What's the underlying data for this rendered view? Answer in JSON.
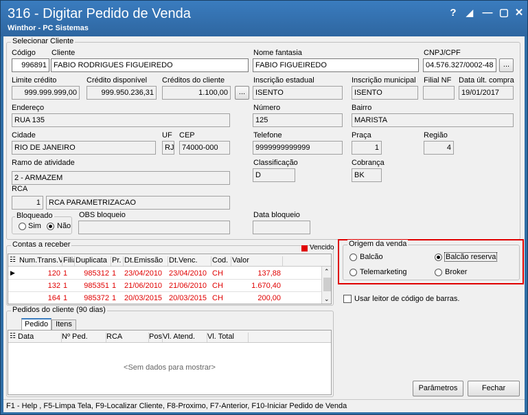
{
  "window": {
    "title": "316 - Digitar Pedido de Venda",
    "subtitle": "Winthor - PC Sistemas",
    "help": "?",
    "restore": "▢",
    "minimize": "—",
    "close": "✕"
  },
  "selecionar": {
    "group_label": "Selecionar Cliente",
    "codigo_label": "Código",
    "codigo": "996891",
    "cliente_label": "Cliente",
    "cliente": "FABIO RODRIGUES FIGUEIREDO",
    "fantasia_label": "Nome fantasia",
    "fantasia": "FABIO FIGUEIREDO",
    "cnpj_label": "CNPJ/CPF",
    "cnpj": "04.576.327/0002-48",
    "limite_label": "Limite crédito",
    "limite": "999.999.999,00",
    "credito_disp_label": "Crédito disponível",
    "credito_disp": "999.950.236,31",
    "creditos_cli_label": "Créditos do cliente",
    "creditos_cli": "1.100,00",
    "ie_label": "Inscrição estadual",
    "ie": "ISENTO",
    "im_label": "Inscrição municipal",
    "im": "ISENTO",
    "filial_label": "Filial NF",
    "filial": "",
    "data_compra_label": "Data últ. compra",
    "data_compra": "19/01/2017",
    "endereco_label": "Endereço",
    "endereco": "RUA 135",
    "numero_label": "Número",
    "numero": "125",
    "bairro_label": "Bairro",
    "bairro": "MARISTA",
    "cidade_label": "Cidade",
    "cidade": "RIO DE JANEIRO",
    "uf_label": "UF",
    "uf": "RJ",
    "cep_label": "CEP",
    "cep": "74000-000",
    "telefone_label": "Telefone",
    "telefone": "9999999999999",
    "praca_label": "Praça",
    "praca": "1",
    "regiao_label": "Região",
    "regiao": "4",
    "ramo_label": "Ramo de atividade",
    "ramo": "2 - ARMAZEM",
    "classificacao_label": "Classificação",
    "classificacao": "D",
    "cobranca_label": "Cobrança",
    "cobranca": "BK",
    "rca_label": "RCA",
    "rca_cod": "1",
    "rca_nome": "RCA PARAMETRIZACAO",
    "bloqueado_label": "Bloqueado",
    "sim": "Sim",
    "nao": "Não",
    "obs_label": "OBS bloqueio",
    "obs": "",
    "data_bloqueio_label": "Data bloqueio",
    "data_bloqueio": "",
    "ellipsis": "..."
  },
  "contas": {
    "group_label": "Contas a receber",
    "vencido_label": "Vencido",
    "vencido_color": "#e00000",
    "headers": [
      "Num.Trans.V",
      "Filia",
      "Duplicata",
      "Pr.",
      "Dt.Emissão",
      "Dt.Venc.",
      "Cod.",
      "Valor"
    ],
    "rows": [
      [
        "120",
        "1",
        "985312",
        "1",
        "23/04/2010",
        "23/04/2010",
        "CH",
        "137,88"
      ],
      [
        "132",
        "1",
        "985351",
        "1",
        "21/06/2010",
        "21/06/2010",
        "CH",
        "1.670,40"
      ],
      [
        "164",
        "1",
        "985372",
        "1",
        "20/03/2015",
        "20/03/2015",
        "CH",
        "200,00"
      ]
    ]
  },
  "origem": {
    "group_label": "Origem da venda",
    "balcao": "Balcão",
    "balcao_reserva": "Balcão reserva",
    "telemarketing": "Telemarketing",
    "broker": "Broker",
    "selected": "balcao_reserva",
    "highlight_color": "#e00000"
  },
  "leitor_label": "Usar leitor de código de barras.",
  "pedidos": {
    "group_label": "Pedidos do cliente (90 dias)",
    "tabs": [
      "Pedido",
      "Itens"
    ],
    "headers": [
      "Data",
      "Nº Ped.",
      "RCA",
      "Pos",
      "Vl. Atend.",
      "Vl. Total"
    ],
    "empty": "<Sem dados para mostrar>"
  },
  "buttons": {
    "parametros": "Parâmetros",
    "fechar": "Fechar"
  },
  "status": "F1 - Help , F5-Limpa Tela, F9-Localizar Cliente, F8-Proximo, F7-Anterior, F10-Iniciar Pedido de Venda"
}
